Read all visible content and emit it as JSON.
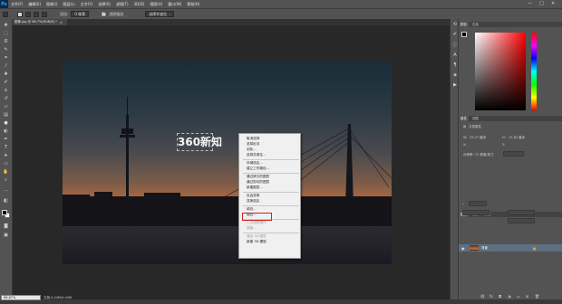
{
  "app": {
    "logo": "Ps"
  },
  "menubar": {
    "items": [
      "文件(F)",
      "编辑(E)",
      "图像(I)",
      "图层(L)",
      "文字(Y)",
      "选择(S)",
      "滤镜(T)",
      "3D(D)",
      "视图(V)",
      "窗口(W)",
      "帮助(H)"
    ],
    "minimize": "—",
    "maximize": "□",
    "close": "✕"
  },
  "optionsbar": {
    "feather_label": "羽化:",
    "feather_value": "0 像素",
    "antialias_label": "消除锯齿",
    "select_mask_label": "选择并遮住..."
  },
  "document": {
    "tab_title": "图像.jpg @ 66.7%(RGB/8) *",
    "tab_close": "×"
  },
  "canvas": {
    "text_layer": "360新知"
  },
  "context_menu": {
    "items": [
      {
        "label": "取消选择",
        "disabled": false
      },
      {
        "label": "选择反向",
        "disabled": false
      },
      {
        "label": "羽化...",
        "disabled": false
      },
      {
        "label": "选择并遮住...",
        "disabled": false
      },
      {
        "sep": true
      },
      {
        "label": "存储选区...",
        "disabled": false
      },
      {
        "label": "建立工作路径...",
        "disabled": false
      },
      {
        "sep": true
      },
      {
        "label": "通过拷贝的图层",
        "disabled": false
      },
      {
        "label": "通过剪切的图层",
        "disabled": false
      },
      {
        "label": "新建图层...",
        "disabled": false
      },
      {
        "sep": true
      },
      {
        "label": "自由变换",
        "disabled": false
      },
      {
        "label": "变换选区",
        "disabled": false
      },
      {
        "sep": true
      },
      {
        "label": "填充...",
        "disabled": false,
        "highlighted": true
      },
      {
        "label": "描边...",
        "disabled": false
      },
      {
        "sep": true
      },
      {
        "label": "上次滤镜操作",
        "disabled": true
      },
      {
        "label": "渐隐...",
        "disabled": true
      },
      {
        "sep": true
      },
      {
        "label": "渲染 3D 图层",
        "disabled": true
      },
      {
        "label": "新建 3D 模型",
        "disabled": false
      }
    ]
  },
  "right_panel": {
    "color_tabs": [
      "颜色",
      "色板"
    ],
    "properties_tabs": [
      "属性",
      "调整"
    ],
    "properties_title": "文档属性",
    "width_label": "W:",
    "width_value": "25.27 厘米",
    "height_label": "H:",
    "height_value": "17.64 厘米",
    "x_label": "X:",
    "y_label": "Y:",
    "resolution": "分辨率: 72 像素/英寸",
    "layers_tabs": [
      "图层",
      "通道",
      "路径"
    ],
    "layer_name": "背景"
  },
  "status": {
    "zoom": "66.67%",
    "doc_info": "文档:4.04M/4.04M"
  },
  "colors": {
    "accent": "#31a8ff",
    "highlight": "#d02020",
    "layer_selected": "#5e6f82"
  }
}
